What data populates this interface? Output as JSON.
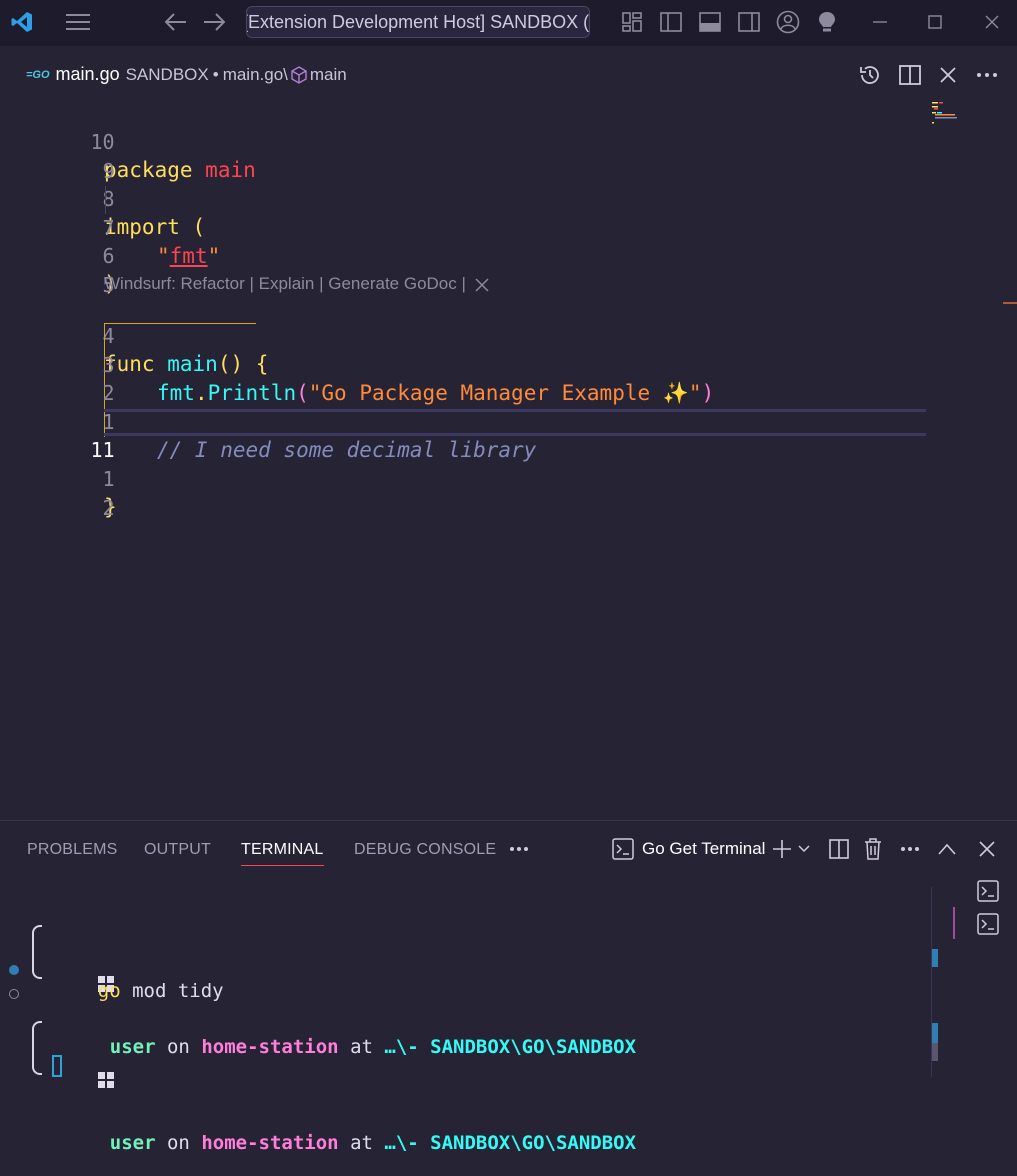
{
  "titlebar": {
    "search_text": "[Extension Development Host] SANDBOX (Workspace)"
  },
  "breadcrumbs": {
    "lang_logo": "=GO",
    "file": "main.go",
    "folder": "SANDBOX",
    "separator1": "•",
    "path": "main.go\\",
    "symbol": "main"
  },
  "editor": {
    "lines": [
      {
        "num": "10"
      },
      {
        "num": "9"
      },
      {
        "num": "8"
      },
      {
        "num": "7"
      },
      {
        "num": "6"
      },
      {
        "num": "5"
      },
      {
        "num": "4"
      },
      {
        "num": "3"
      },
      {
        "num": "2"
      },
      {
        "num": "1"
      },
      {
        "num": "11"
      },
      {
        "num": "1"
      },
      {
        "num": "2"
      }
    ],
    "code": {
      "package_kw": "package",
      "package_name": "main",
      "import_kw": "import",
      "import_paren": "(",
      "fmt_str": "fmt",
      "close_paren": ")",
      "func_kw": "func",
      "func_name": "main",
      "func_sig": "() {",
      "fmt_pkg": "fmt",
      "println": "Println",
      "string_literal": "\"Go Package Manager Example ✨\"",
      "comment": "// I need some decimal library",
      "close_brace": "}"
    },
    "codelens": "Windsurf: Refactor | Explain | Generate GoDoc |"
  },
  "panel": {
    "tabs": [
      "PROBLEMS",
      "OUTPUT",
      "TERMINAL",
      "DEBUG CONSOLE"
    ],
    "active_tab": "TERMINAL",
    "terminal_name": "Go Get Terminal"
  },
  "terminal": {
    "user": "user",
    "on": "on",
    "host": "home-station",
    "at": "at",
    "path": "…\\- SANDBOX\\GO\\SANDBOX",
    "cmd_go": "go",
    "cmd_rest": "mod tidy"
  }
}
